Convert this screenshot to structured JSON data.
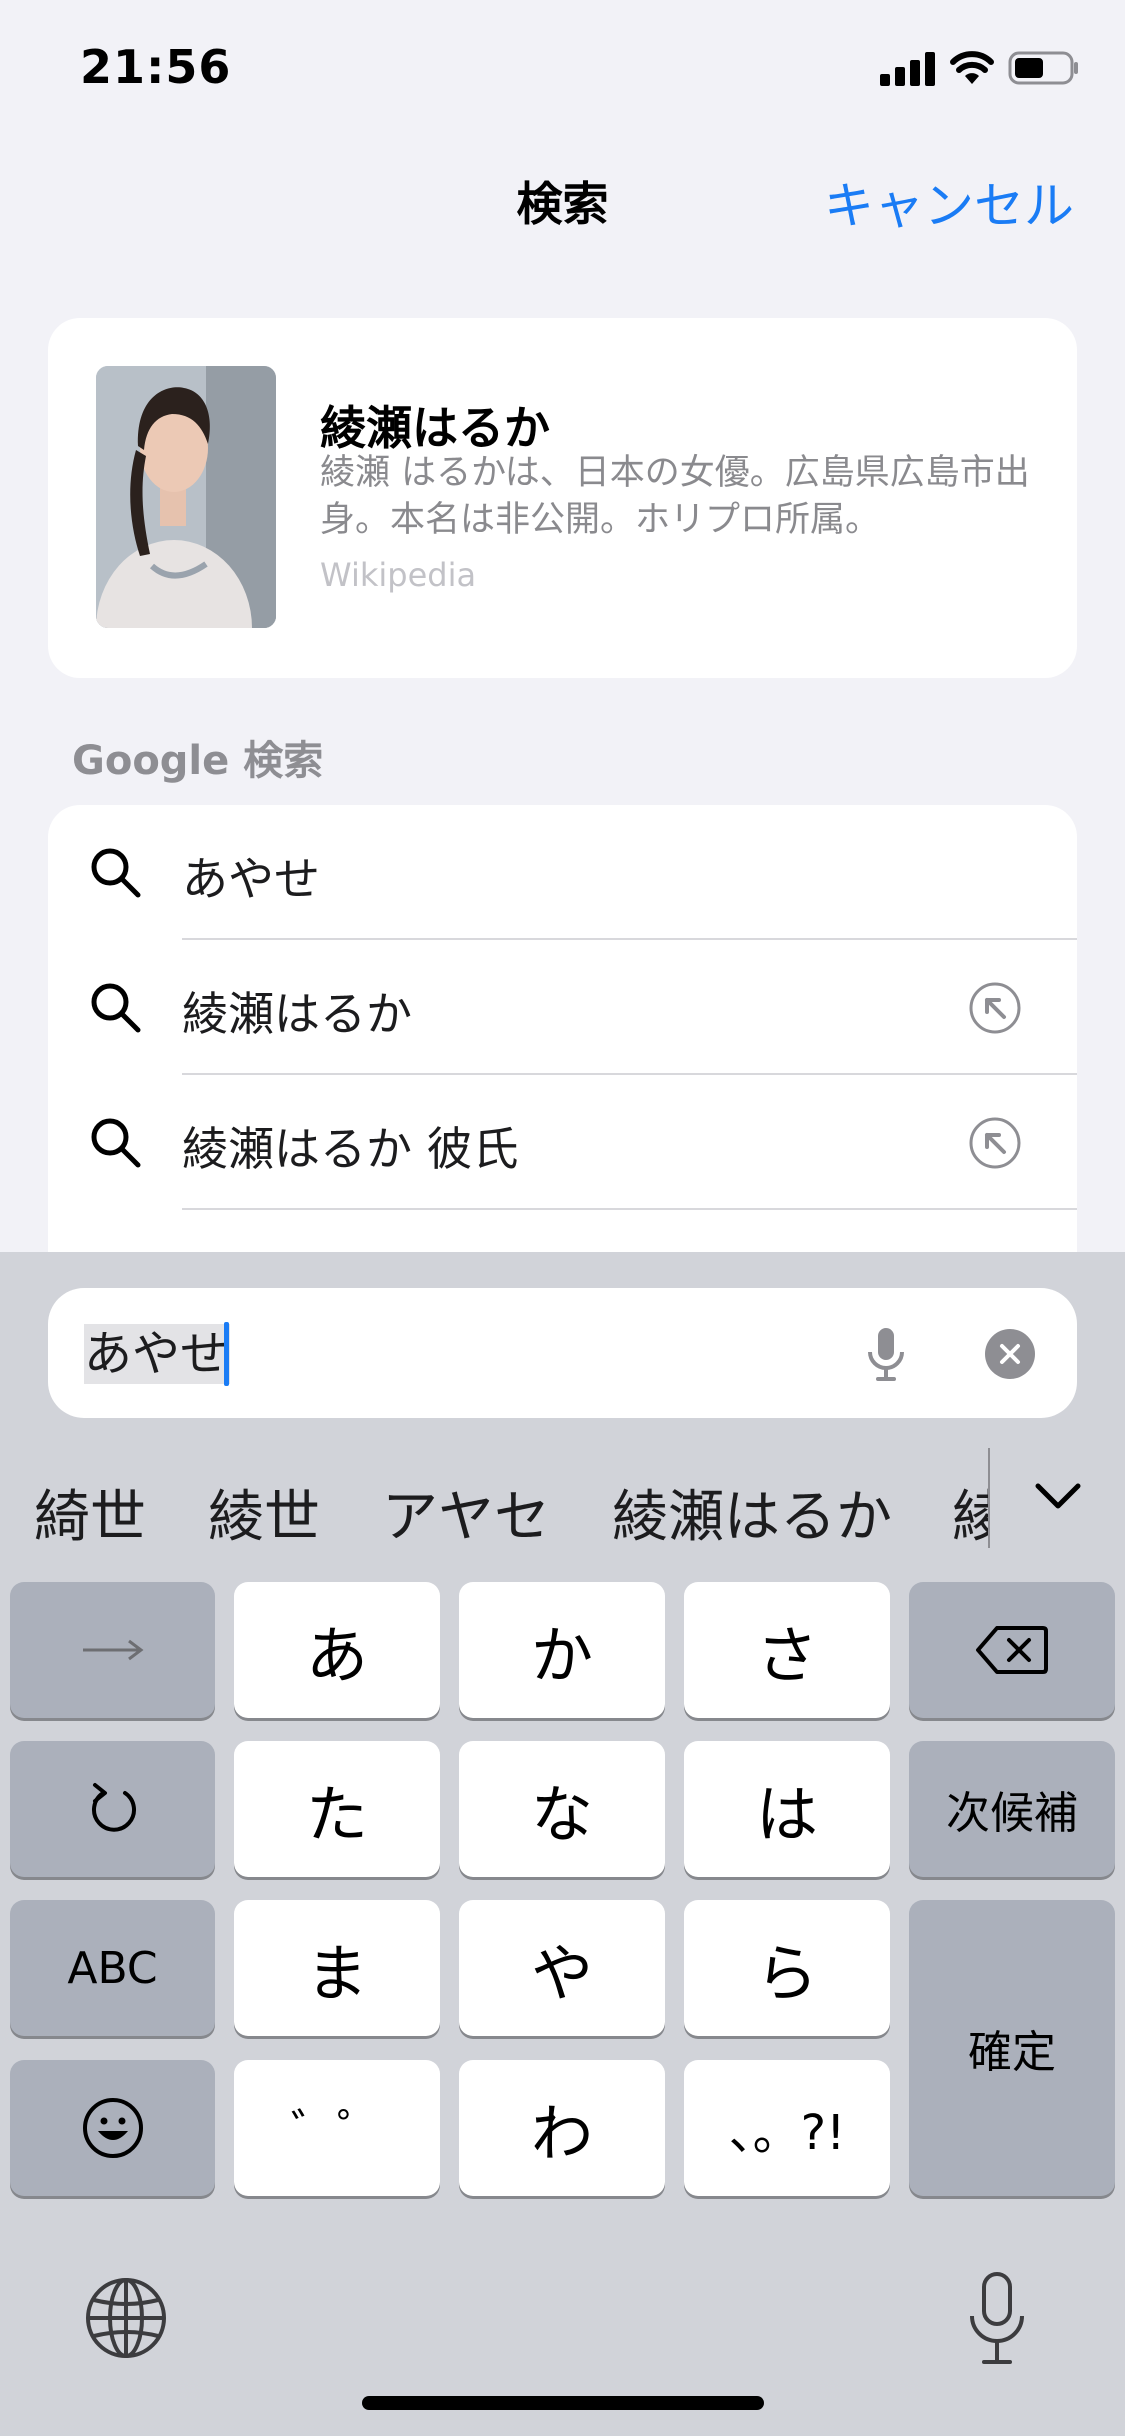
{
  "status": {
    "time": "21:56"
  },
  "nav": {
    "title": "検索",
    "cancel_label": "キャンセル"
  },
  "knowledge_card": {
    "title": "綾瀬はるか",
    "description": "綾瀬 はるかは、日本の女優。広島県広島市出身。本名は非公開。ホリプロ所属。",
    "source": "Wikipedia"
  },
  "google": {
    "header": "Google 検索",
    "suggestions": [
      {
        "text": "あやせ",
        "has_fill_arrow": false
      },
      {
        "text": "綾瀬はるか",
        "has_fill_arrow": true
      },
      {
        "text": "綾瀬はるか 彼氏",
        "has_fill_arrow": true
      }
    ]
  },
  "search_field": {
    "value": "あやせ"
  },
  "candidates": [
    "綺世",
    "綾世",
    "アヤセ",
    "綾瀬はるか",
    "綾"
  ],
  "keyboard": {
    "row1": [
      "→",
      "あ",
      "か",
      "さ",
      "⌫"
    ],
    "row2": [
      "↺",
      "た",
      "な",
      "は",
      "次候補"
    ],
    "row3": [
      "ABC",
      "ま",
      "や",
      "ら"
    ],
    "row4": [
      "☺",
      "゛゜",
      "わ",
      "、。?!"
    ],
    "confirm": "確定"
  },
  "colors": {
    "accent": "#1a7cf5",
    "keyboard_bg": "#d1d3d9",
    "function_key": "#abb0bb"
  }
}
